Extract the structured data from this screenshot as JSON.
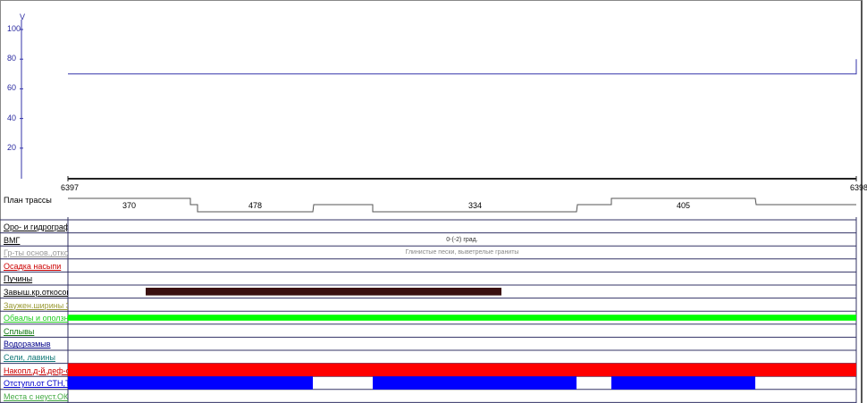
{
  "speed_chart": {
    "axis_label": "V",
    "ticks": [
      "100",
      "80",
      "60",
      "40",
      "20"
    ],
    "speed_value": 70,
    "speed_end_value": 80,
    "axis_max": 100
  },
  "km": {
    "start": "6397",
    "end": "6398"
  },
  "plan": {
    "title": "План трассы",
    "segments": [
      "370",
      "478",
      "334",
      "405"
    ]
  },
  "rows": [
    {
      "label": "Оро- и гидрография",
      "color": "#000000"
    },
    {
      "label": "ВМГ",
      "color": "#000000",
      "text": "0-(-2) град."
    },
    {
      "label": "Гр-ты основ.,откос",
      "color": "#999999",
      "text": "Глинистые пески, выветрелые граниты"
    },
    {
      "label": "Осадка насыпи",
      "color": "#cc0000"
    },
    {
      "label": "Пучины",
      "color": "#000000"
    },
    {
      "label": "Завыш.кр.откосов",
      "color": "#000000"
    },
    {
      "label": "Заужен.ширины ЗП",
      "color": "#999933"
    },
    {
      "label": "Обвалы и оползни",
      "color": "#22cc22"
    },
    {
      "label": "Сплывы",
      "color": "#117711"
    },
    {
      "label": "Водоразмыв",
      "color": "#000088"
    },
    {
      "label": "Сели, лавины",
      "color": "#117777"
    },
    {
      "label": "Накопл.д-й.деф-ов.",
      "color": "#cc0000"
    },
    {
      "label": "Отступл.от СТН,ТУ",
      "color": "#0000cc"
    },
    {
      "label": "Места с неуст.ОКС",
      "color": "#44aa44"
    }
  ],
  "colors": {
    "axis": "#3333aa",
    "grid": "#333366",
    "brown": "#3a1010",
    "green": "#00ff00",
    "red": "#ff0000",
    "blue": "#0000ff"
  }
}
